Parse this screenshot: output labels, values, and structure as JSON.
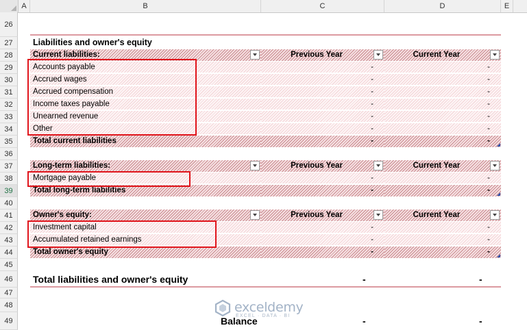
{
  "columns": [
    "A",
    "B",
    "C",
    "D",
    "E"
  ],
  "rows": [
    "26",
    "27",
    "28",
    "29",
    "30",
    "31",
    "32",
    "33",
    "34",
    "35",
    "36",
    "37",
    "38",
    "39",
    "40",
    "41",
    "42",
    "43",
    "44",
    "45",
    "46",
    "47",
    "48",
    "49"
  ],
  "selected_row": "39",
  "section_title": "Liabilities and owner's equity",
  "current_liabilities": {
    "header": "Current liabilities:",
    "previous_year": "Previous Year",
    "current_year": "Current Year",
    "items": [
      {
        "label": "Accounts payable",
        "prev": "-",
        "curr": "-"
      },
      {
        "label": "Accrued wages",
        "prev": "-",
        "curr": "-"
      },
      {
        "label": "Accrued compensation",
        "prev": "-",
        "curr": "-"
      },
      {
        "label": "Income taxes payable",
        "prev": "-",
        "curr": "-"
      },
      {
        "label": "Unearned revenue",
        "prev": "-",
        "curr": "-"
      },
      {
        "label": "Other",
        "prev": "-",
        "curr": "-"
      }
    ],
    "total": {
      "label": "Total current liabilities",
      "prev": "-",
      "curr": "-"
    }
  },
  "long_term_liabilities": {
    "header": "Long-term liabilities:",
    "previous_year": "Previous Year",
    "current_year": "Current Year",
    "items": [
      {
        "label": "Mortgage payable",
        "prev": "-",
        "curr": "-"
      }
    ],
    "total": {
      "label": "Total long-term liabilities",
      "prev": "-",
      "curr": "-"
    }
  },
  "owners_equity": {
    "header": "Owner's equity:",
    "previous_year": "Previous Year",
    "current_year": "Current Year",
    "items": [
      {
        "label": "Investment capital",
        "prev": "-",
        "curr": "-"
      },
      {
        "label": "Accumulated retained earnings",
        "prev": "-",
        "curr": "-"
      }
    ],
    "total": {
      "label": "Total owner's equity",
      "prev": "-",
      "curr": "-"
    }
  },
  "grand_total": {
    "label": "Total liabilities and owner's equity",
    "prev": "-",
    "curr": "-"
  },
  "balance": {
    "label": "Balance",
    "prev": "-",
    "curr": "-"
  },
  "watermark": {
    "name": "exceldemy",
    "tagline": "EXCEL · DATA · BI"
  },
  "colors": {
    "header_hatch": "#c98a8e",
    "row_hatch": "#f4d4d6",
    "highlight_box": "#e0141b",
    "divider": "#dc9aa0"
  }
}
